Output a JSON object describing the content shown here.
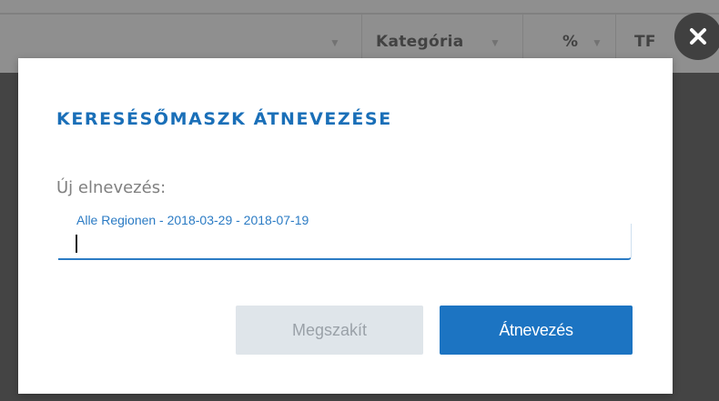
{
  "background_table": {
    "columns": [
      {
        "label": ""
      },
      {
        "label": "Kategória"
      },
      {
        "label": "%"
      },
      {
        "label": "TF"
      }
    ]
  },
  "dialog": {
    "title": "KERESÉSŐMASZK ÁTNEVEZÉSE",
    "field_label": "Új elnevezés:",
    "field_floating_value": "Alle Regionen - 2018-03-29 - 2018-07-19",
    "field_value": "",
    "cancel_label": "Megszakít",
    "confirm_label": "Átnevezés",
    "close_icon": "close-icon"
  },
  "colors": {
    "accent": "#1c74c2",
    "title": "#1a6fb8",
    "cancel_bg": "#dfe5ea"
  }
}
